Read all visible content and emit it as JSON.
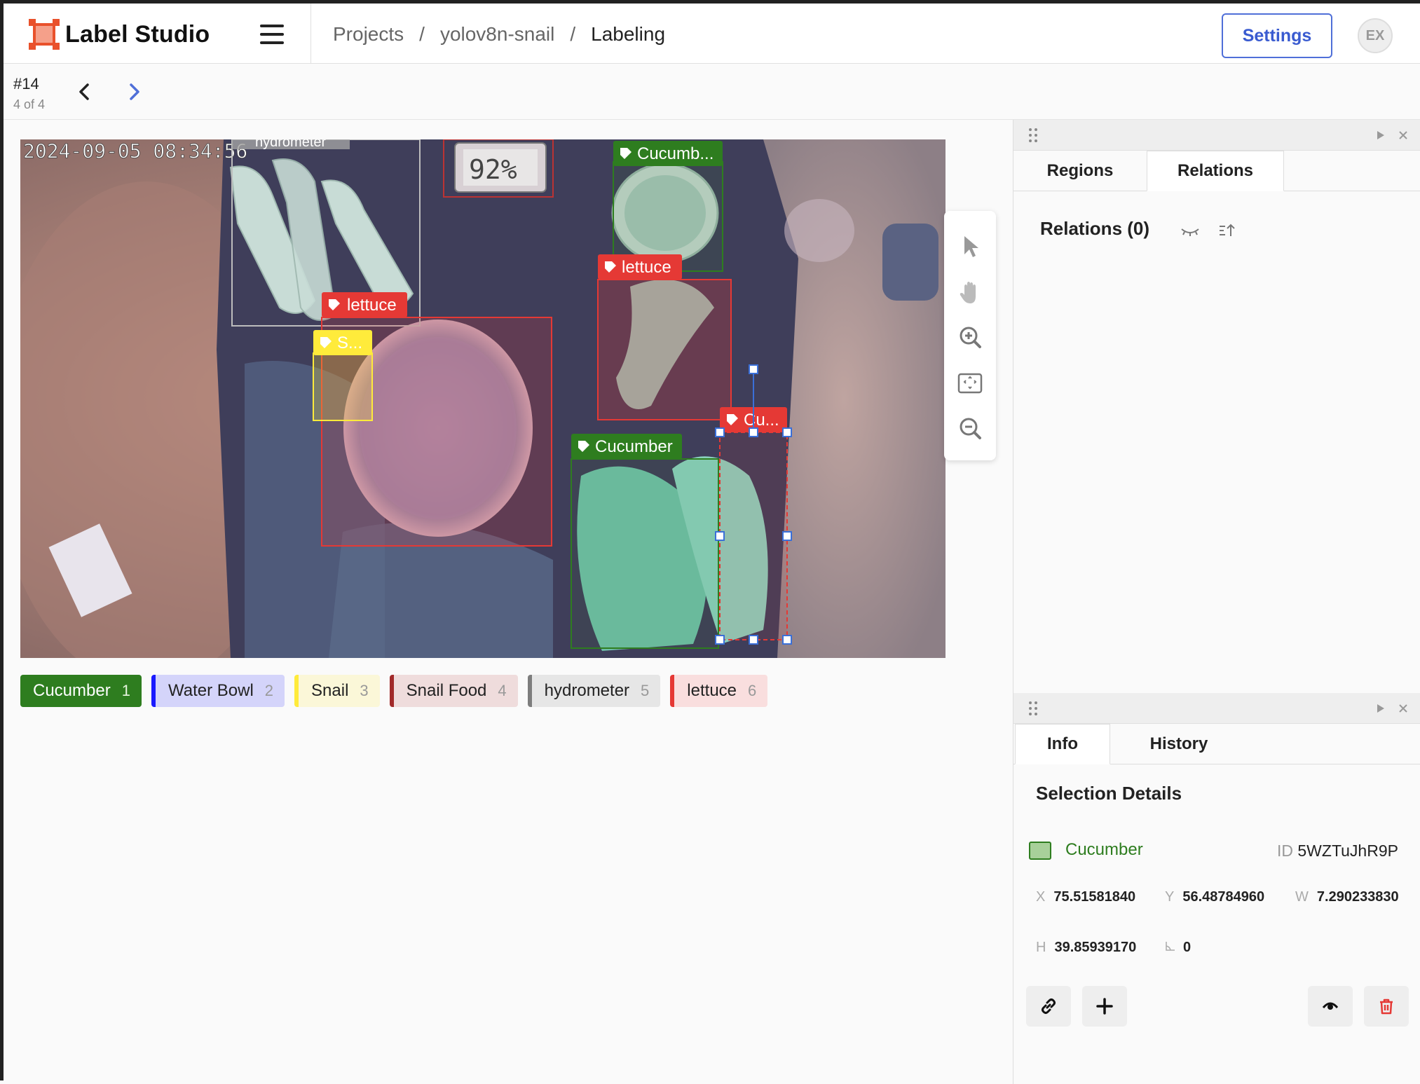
{
  "app": {
    "name": "Label Studio"
  },
  "breadcrumb": {
    "projects": "Projects",
    "sep1": "/",
    "project": "yolov8n-snail",
    "sep2": "/",
    "page": "Labeling"
  },
  "header": {
    "settings_label": "Settings",
    "avatar_initials": "EX"
  },
  "task": {
    "id": "#14",
    "position": "4 of 4"
  },
  "image": {
    "timestamp": "2024-09-05 08:34:56",
    "hygrometer_reading": "92%"
  },
  "regions": [
    {
      "label": "hydrometer",
      "color": "#9e9e9e"
    },
    {
      "label": "Cucumb...",
      "color": "#2e7d1f"
    },
    {
      "label": "lettuce",
      "color": "#e53935"
    },
    {
      "label": "lettuce",
      "color": "#e53935"
    },
    {
      "label": "S...",
      "color": "#ffeb3b"
    },
    {
      "label": "Cucumber",
      "color": "#2e7d1f"
    },
    {
      "label": "Cu...",
      "color": "#e53935"
    }
  ],
  "labels": [
    {
      "name": "Cucumber",
      "hotkey": "1",
      "color": "#2e7d1f",
      "selected": true
    },
    {
      "name": "Water Bowl",
      "hotkey": "2",
      "color": "#1a1aff",
      "bg": "#d4d4fa"
    },
    {
      "name": "Snail",
      "hotkey": "3",
      "color": "#ffeb3b",
      "bg": "#fbf7d8"
    },
    {
      "name": "Snail Food",
      "hotkey": "4",
      "color": "#a12a2a",
      "bg": "#efdcdc"
    },
    {
      "name": "hydrometer",
      "hotkey": "5",
      "color": "#7d7d7d",
      "bg": "#e6e6e6"
    },
    {
      "name": "lettuce",
      "hotkey": "6",
      "color": "#e53935",
      "bg": "#f9dede"
    }
  ],
  "top_panel": {
    "tabs": [
      "Regions",
      "Relations"
    ],
    "active_tab": "Relations",
    "relations_title": "Relations (0)"
  },
  "bottom_panel": {
    "tabs": [
      "Info",
      "History"
    ],
    "active_tab": "Info",
    "title": "Selection Details",
    "selected_label": "Cucumber",
    "id_label": "ID",
    "id_value": "5WZTuJhR9P",
    "x_label": "X",
    "x_value": "75.51581840",
    "y_label": "Y",
    "y_value": "56.48784960",
    "w_label": "W",
    "w_value": "7.290233830",
    "h_label": "H",
    "h_value": "39.85939170",
    "angle_value": "0"
  }
}
